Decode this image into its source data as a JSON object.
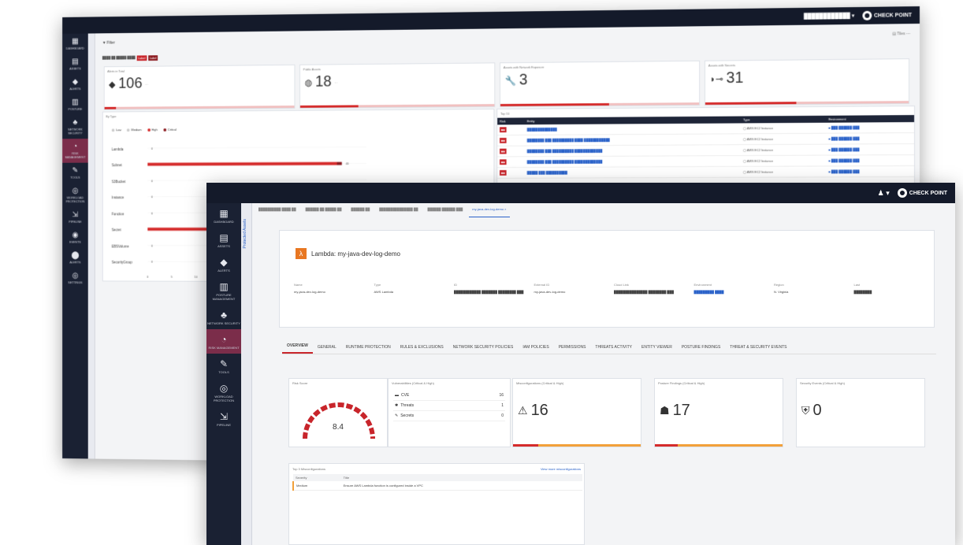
{
  "w1": {
    "filter_label": "▼ Filter",
    "filter_right": "▤ Tiles ⋯",
    "chips": [
      "Label",
      "Label"
    ],
    "topbar_user": "████████████ ▾",
    "brand": "CHECK POINT",
    "sidebar": [
      {
        "icon": "grid-icon",
        "glyph": "▦",
        "label": "DASHBOARD"
      },
      {
        "icon": "assets-icon",
        "glyph": "▤",
        "label": "ASSETS"
      },
      {
        "icon": "shield-icon",
        "glyph": "◆",
        "label": "ALERTS"
      },
      {
        "icon": "building-icon",
        "glyph": "▥",
        "label": "POSTURE"
      },
      {
        "icon": "network-icon",
        "glyph": "♣",
        "label": "NETWORK SECURITY"
      },
      {
        "icon": "risk-icon",
        "glyph": "◔",
        "label": "RISK MANAGEMENT",
        "active": true
      },
      {
        "icon": "tools-icon",
        "glyph": "✎",
        "label": "TOOLS"
      },
      {
        "icon": "workload-icon",
        "glyph": "◎",
        "label": "WORKLOAD PROTECTION"
      },
      {
        "icon": "pipeline-icon",
        "glyph": "⇲",
        "label": "PIPELINE"
      },
      {
        "icon": "events-icon",
        "glyph": "◉",
        "label": "EVENTS"
      },
      {
        "icon": "pin-icon",
        "glyph": "⬤",
        "label": "ALERTS"
      },
      {
        "icon": "settings-icon",
        "glyph": "◎",
        "label": "SETTINGS"
      }
    ],
    "kpis": [
      {
        "title": "Alerts in Total",
        "icon": "diamond-icon",
        "glyph": "◆",
        "value": "106",
        "suffix": "...",
        "fill": 0.06
      },
      {
        "title": "Public Assets",
        "icon": "globe-icon",
        "glyph": "◍",
        "value": "18",
        "suffix": "...",
        "fill": 0.3
      },
      {
        "title": "Assets with Network Exposure",
        "icon": "wrench-icon",
        "glyph": "🔧",
        "value": "3",
        "suffix": "",
        "fill": 0.55
      },
      {
        "title": "Assets with Secrets",
        "icon": "key-icon",
        "glyph": "◗⊸",
        "value": "31",
        "suffix": "",
        "fill": 0.45
      }
    ],
    "chart_title": "By Type",
    "legend": [
      "Low",
      "Medium",
      "High",
      "Critical"
    ],
    "table_title": "Top 10",
    "table_headers": [
      "Risk",
      "Entity",
      "Type",
      "Environment"
    ],
    "table_rows": [
      [
        "",
        "██████████████",
        "▢ AWS EC2 Instance",
        "■ ███ ██████ ███"
      ],
      [
        "",
        "████████ ███ ██████████ ████ ████████████",
        "▢ AWS EC2 Instance",
        "■ ███ ██████ ███"
      ],
      [
        "",
        "████████ ███ ██████████ █████████████",
        "▢ AWS EC2 Instance",
        "■ ███ ██████ ███"
      ],
      [
        "",
        "████████ ███ ██████████ █████████████",
        "▢ AWS EC2 Instance",
        "■ ███ ██████ ███"
      ],
      [
        "",
        "█████ ███ ██████████",
        "▢ AWS EC2 Instance",
        "■ ███ ██████ ███"
      ]
    ]
  },
  "chart_data": {
    "type": "bar",
    "categories": [
      "Lambda",
      "Subnet",
      "S3Bucket",
      "Instance",
      "Function",
      "Secret",
      "EBSVolume",
      "SecurityGroup"
    ],
    "series": [
      {
        "name": "High",
        "values": [
          0,
          39,
          0,
          0,
          0,
          18,
          0,
          0
        ]
      },
      {
        "name": "Critical",
        "values": [
          0,
          1,
          0,
          0,
          0,
          1,
          0,
          0
        ]
      }
    ],
    "colors": [
      "#d52b2b",
      "#8b1a1f"
    ],
    "xlim": [
      0,
      45
    ]
  },
  "w2": {
    "brand": "CHECK POINT",
    "vbar_label": "Protected Assets",
    "tabs_open": [
      "██████████ ████ ██",
      "██████ ██ █████ ██",
      "██████ ██",
      "███████████████ ██",
      "██████ ██████ ███",
      "my-java-dev-log-demo ×"
    ],
    "sidebar": [
      {
        "icon": "grid-icon",
        "glyph": "▦",
        "label": "DASHBOARD"
      },
      {
        "icon": "assets-icon",
        "glyph": "▤",
        "label": "ASSETS"
      },
      {
        "icon": "shield-icon",
        "glyph": "◆",
        "label": "ALERTS"
      },
      {
        "icon": "building-icon",
        "glyph": "▥",
        "label": "POSTURE MANAGEMENT"
      },
      {
        "icon": "network-icon",
        "glyph": "♣",
        "label": "NETWORK SECURITY"
      },
      {
        "icon": "risk-icon",
        "glyph": "◔",
        "label": "RISK MANAGEMENT",
        "active": true
      },
      {
        "icon": "tools-icon",
        "glyph": "✎",
        "label": "TOOLS"
      },
      {
        "icon": "workload-icon",
        "glyph": "◎",
        "label": "WORKLOAD PROTECTION"
      },
      {
        "icon": "pipeline-icon",
        "glyph": "⇲",
        "label": "PIPELINE"
      }
    ],
    "asset_title": "Lambda: my-java-dev-log-demo",
    "asset_fields": [
      {
        "k": "Name",
        "v": "my-java-dev-log-demo"
      },
      {
        "k": "Type",
        "v": "AWS Lambda"
      },
      {
        "k": "ID",
        "v": "████████████ ███████ ████████ ███"
      },
      {
        "k": "External ID",
        "v": "my-java-dev-log-demo"
      },
      {
        "k": "Cloud Link",
        "v": "███████████████ ████████ ███"
      },
      {
        "k": "Environment",
        "v": "█████████ ████"
      },
      {
        "k": "Region",
        "v": "N. Virginia"
      },
      {
        "k": "Last",
        "v": "████████"
      }
    ],
    "tabs": [
      "OVERVIEW",
      "GENERAL",
      "RUNTIME PROTECTION",
      "RULES & EXCLUSIONS",
      "NETWORK SECURITY POLICIES",
      "IAM POLICIES",
      "PERMISSIONS",
      "THREATS ACTIVITY",
      "ENTITY VIEWER",
      "POSTURE FINDINGS",
      "THREAT & SECURITY EVENTS"
    ],
    "risk_title": "Risk Score",
    "risk_value": "8.4",
    "vuln_title": "Vulnerabilities (Critical & High)",
    "vuln_rows": [
      {
        "icon": "cve-icon",
        "glyph": "▬",
        "label": "CVE",
        "n": "16"
      },
      {
        "icon": "threat-icon",
        "glyph": "✱",
        "label": "Threats",
        "n": "1"
      },
      {
        "icon": "secret-icon",
        "glyph": "✎",
        "label": "Secrets",
        "n": "0"
      }
    ],
    "misconf_title": "Misconfigurations (Critical & High)",
    "misconf_value": "16",
    "posture_title": "Posture Findings (Critical & High)",
    "posture_value": "17",
    "secevt_title": "Security Events (Critical & High)",
    "secevt_value": "0",
    "top3_title": "Top 3 Misconfigurations",
    "top3_link": "View more misconfigurations",
    "top3_headers": [
      "Severity",
      "Title"
    ],
    "top3_rows": [
      [
        "Medium",
        "Ensure AWS Lambda function is configured inside a VPC"
      ]
    ]
  }
}
